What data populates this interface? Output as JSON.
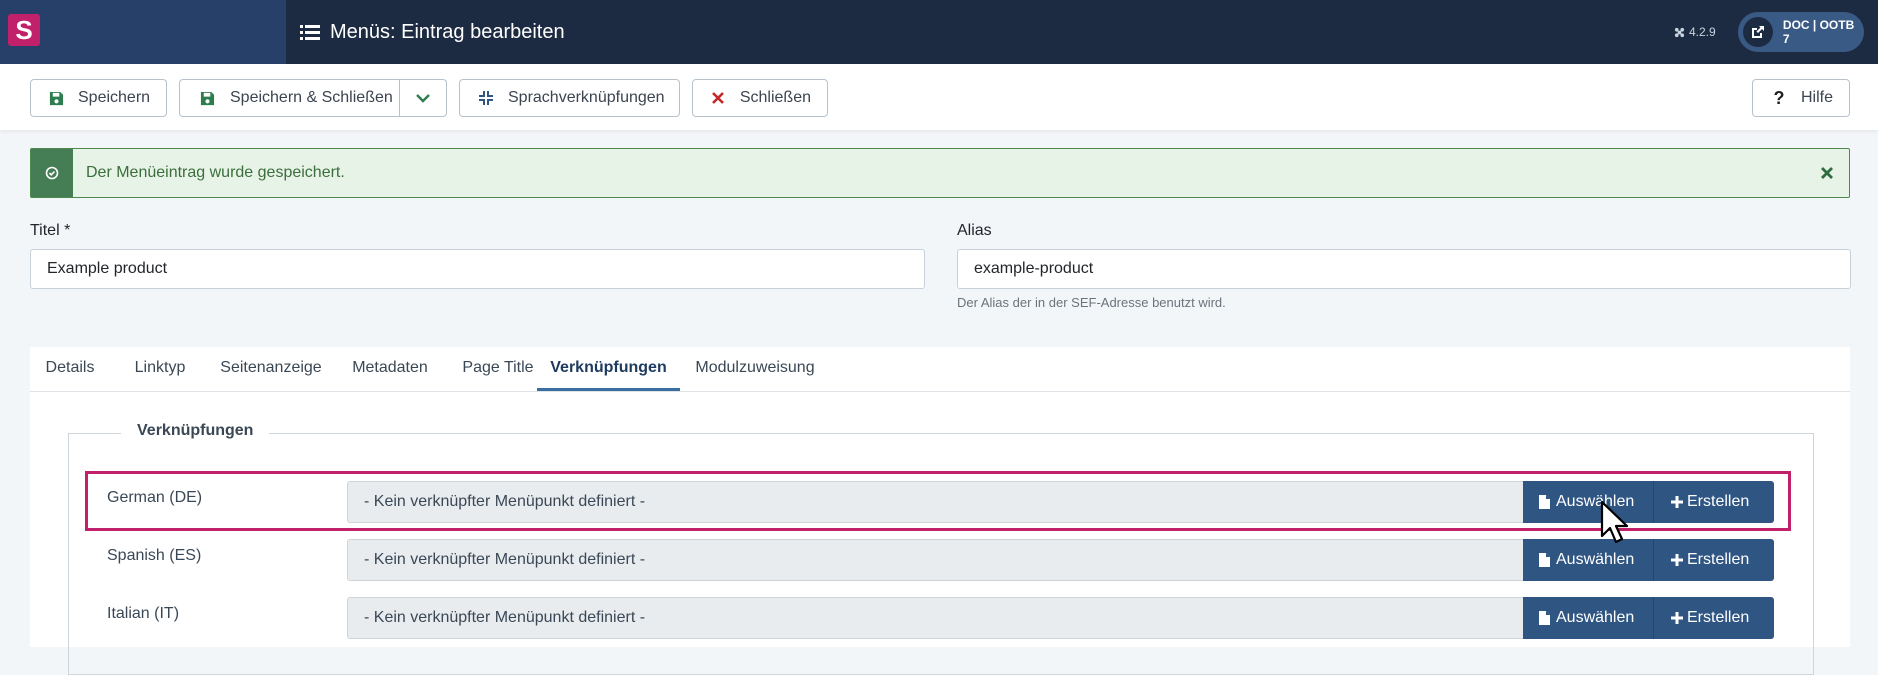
{
  "header": {
    "logo_letter": "S",
    "title": "Menüs: Eintrag bearbeiten",
    "version": "4.2.9",
    "site_label": "DOC | OOTB 7"
  },
  "toolbar": {
    "save_label": "Speichern",
    "save_close_label": "Speichern & Schließen",
    "associations_label": "Sprachverknüpfungen",
    "close_label": "Schließen",
    "help_label": "Hilfe"
  },
  "alert": {
    "message": "Der Menüeintrag wurde gespeichert."
  },
  "form": {
    "title_label": "Titel *",
    "title_value": "Example product",
    "alias_label": "Alias",
    "alias_value": "example-product",
    "alias_hint": "Der Alias der in der SEF-Adresse benutzt wird."
  },
  "tabs": [
    {
      "label": "Details"
    },
    {
      "label": "Linktyp"
    },
    {
      "label": "Seitenanzeige"
    },
    {
      "label": "Metadaten"
    },
    {
      "label": "Page Title"
    },
    {
      "label": "Verknüpfungen"
    },
    {
      "label": "Modulzuweisung"
    }
  ],
  "active_tab": "Verknüpfungen",
  "associations": {
    "legend": "Verknüpfungen",
    "rows": [
      {
        "language": "German (DE)",
        "value": "- Kein verknüpfter Menüpunkt definiert -",
        "select_label": "Auswählen",
        "create_label": "Erstellen"
      },
      {
        "language": "Spanish (ES)",
        "value": "- Kein verknüpfter Menüpunkt definiert -",
        "select_label": "Auswählen",
        "create_label": "Erstellen"
      },
      {
        "language": "Italian (IT)",
        "value": "- Kein verknüpfter Menüpunkt definiert -",
        "select_label": "Auswählen",
        "create_label": "Erstellen"
      }
    ]
  },
  "colors": {
    "header_bg": "#1c2b42",
    "logo_bg": "#c1206a",
    "primary_button": "#2f5583",
    "highlight": "#c1206a",
    "success": "#457d54"
  }
}
